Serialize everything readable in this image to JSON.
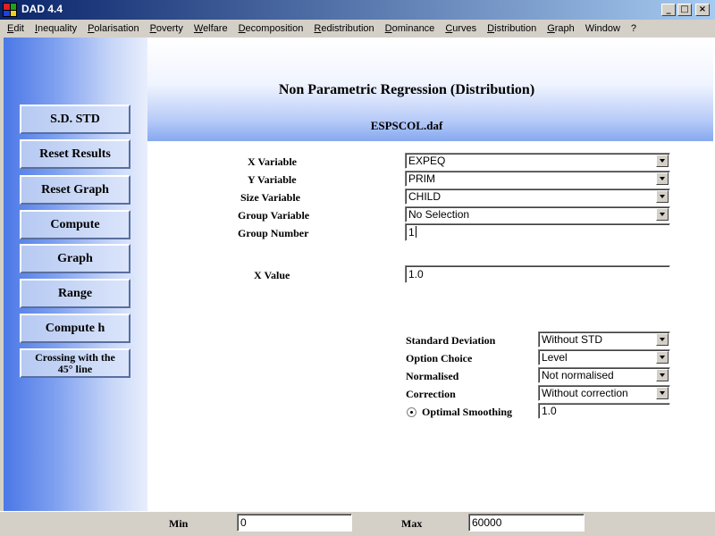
{
  "window": {
    "title": "DAD 4.4"
  },
  "menu": [
    {
      "pre": "",
      "u": "E",
      "post": "dit"
    },
    {
      "pre": "",
      "u": "I",
      "post": "nequality"
    },
    {
      "pre": "",
      "u": "P",
      "post": "olarisation"
    },
    {
      "pre": "",
      "u": "P",
      "post": "overty"
    },
    {
      "pre": "",
      "u": "W",
      "post": "elfare"
    },
    {
      "pre": "",
      "u": "D",
      "post": "ecomposition"
    },
    {
      "pre": "",
      "u": "R",
      "post": "edistribution"
    },
    {
      "pre": "",
      "u": "D",
      "post": "ominance"
    },
    {
      "pre": "",
      "u": "C",
      "post": "urves"
    },
    {
      "pre": "",
      "u": "D",
      "post": "istribution"
    },
    {
      "pre": "",
      "u": "G",
      "post": "raph"
    },
    {
      "pre": "",
      "u": "",
      "post": "Window"
    },
    {
      "pre": "",
      "u": "",
      "post": "?"
    }
  ],
  "header": {
    "title": "Non Parametric Regression (Distribution)",
    "file": "ESPSCOL.daf"
  },
  "sidebar": {
    "sd_std": "S.D. STD",
    "reset_results": "Reset Results",
    "reset_graph": "Reset Graph",
    "compute": "Compute",
    "graph": "Graph",
    "range": "Range",
    "compute_h": "Compute h",
    "crossing_line1": "Crossing with the",
    "crossing_line2": "45° line"
  },
  "form": {
    "x_variable": {
      "label": "X Variable",
      "value": "EXPEQ"
    },
    "y_variable": {
      "label": "Y Variable",
      "value": "PRIM"
    },
    "size_variable": {
      "label": "Size Variable",
      "value": "CHILD"
    },
    "group_variable": {
      "label": "Group Variable",
      "value": "No Selection"
    },
    "group_number": {
      "label": "Group Number",
      "value": "1"
    },
    "x_value": {
      "label": "X Value",
      "value": "1.0"
    }
  },
  "options": {
    "standard_deviation": {
      "label": "Standard Deviation",
      "value": "Without STD"
    },
    "option_choice": {
      "label": "Option Choice",
      "value": "Level"
    },
    "normalised": {
      "label": "Normalised",
      "value": "Not normalised"
    },
    "correction": {
      "label": "Correction",
      "value": "Without correction"
    },
    "optimal_smoothing": {
      "label": "Optimal Smoothing",
      "value": "1.0"
    }
  },
  "status": {
    "min_label": "Min",
    "min_value": "0",
    "max_label": "Max",
    "max_value": "60000"
  }
}
